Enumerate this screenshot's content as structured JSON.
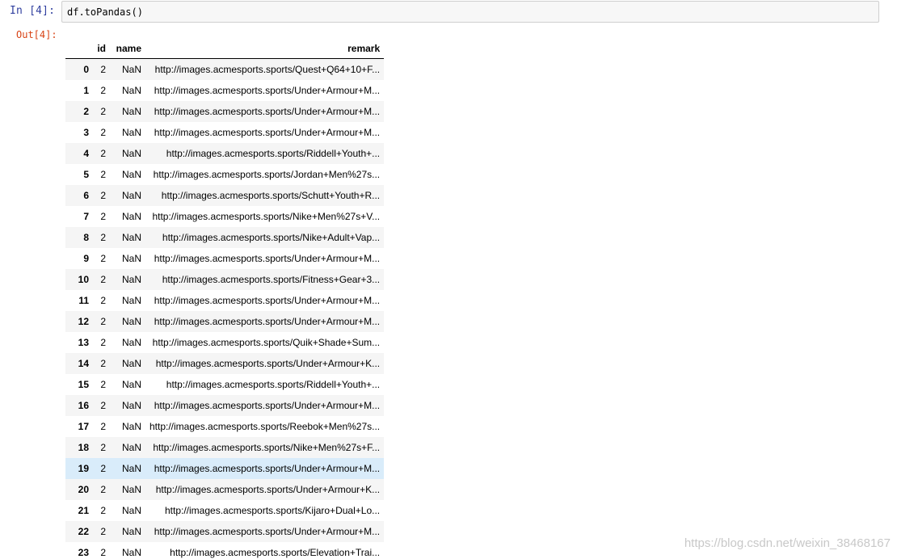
{
  "cell": {
    "in_prompt": "In  [4]:",
    "code": "df.toPandas()",
    "out_prompt": "Out[4]:"
  },
  "table": {
    "columns": [
      "",
      "id",
      "name",
      "remark"
    ],
    "rows": [
      {
        "idx": "0",
        "id": "2",
        "name": "NaN",
        "remark": "http://images.acmesports.sports/Quest+Q64+10+F..."
      },
      {
        "idx": "1",
        "id": "2",
        "name": "NaN",
        "remark": "http://images.acmesports.sports/Under+Armour+M..."
      },
      {
        "idx": "2",
        "id": "2",
        "name": "NaN",
        "remark": "http://images.acmesports.sports/Under+Armour+M..."
      },
      {
        "idx": "3",
        "id": "2",
        "name": "NaN",
        "remark": "http://images.acmesports.sports/Under+Armour+M..."
      },
      {
        "idx": "4",
        "id": "2",
        "name": "NaN",
        "remark": "http://images.acmesports.sports/Riddell+Youth+..."
      },
      {
        "idx": "5",
        "id": "2",
        "name": "NaN",
        "remark": "http://images.acmesports.sports/Jordan+Men%27s..."
      },
      {
        "idx": "6",
        "id": "2",
        "name": "NaN",
        "remark": "http://images.acmesports.sports/Schutt+Youth+R..."
      },
      {
        "idx": "7",
        "id": "2",
        "name": "NaN",
        "remark": "http://images.acmesports.sports/Nike+Men%27s+V..."
      },
      {
        "idx": "8",
        "id": "2",
        "name": "NaN",
        "remark": "http://images.acmesports.sports/Nike+Adult+Vap..."
      },
      {
        "idx": "9",
        "id": "2",
        "name": "NaN",
        "remark": "http://images.acmesports.sports/Under+Armour+M..."
      },
      {
        "idx": "10",
        "id": "2",
        "name": "NaN",
        "remark": "http://images.acmesports.sports/Fitness+Gear+3..."
      },
      {
        "idx": "11",
        "id": "2",
        "name": "NaN",
        "remark": "http://images.acmesports.sports/Under+Armour+M..."
      },
      {
        "idx": "12",
        "id": "2",
        "name": "NaN",
        "remark": "http://images.acmesports.sports/Under+Armour+M..."
      },
      {
        "idx": "13",
        "id": "2",
        "name": "NaN",
        "remark": "http://images.acmesports.sports/Quik+Shade+Sum..."
      },
      {
        "idx": "14",
        "id": "2",
        "name": "NaN",
        "remark": "http://images.acmesports.sports/Under+Armour+K..."
      },
      {
        "idx": "15",
        "id": "2",
        "name": "NaN",
        "remark": "http://images.acmesports.sports/Riddell+Youth+..."
      },
      {
        "idx": "16",
        "id": "2",
        "name": "NaN",
        "remark": "http://images.acmesports.sports/Under+Armour+M..."
      },
      {
        "idx": "17",
        "id": "2",
        "name": "NaN",
        "remark": "http://images.acmesports.sports/Reebok+Men%27s..."
      },
      {
        "idx": "18",
        "id": "2",
        "name": "NaN",
        "remark": "http://images.acmesports.sports/Nike+Men%27s+F..."
      },
      {
        "idx": "19",
        "id": "2",
        "name": "NaN",
        "remark": "http://images.acmesports.sports/Under+Armour+M...",
        "highlight": true
      },
      {
        "idx": "20",
        "id": "2",
        "name": "NaN",
        "remark": "http://images.acmesports.sports/Under+Armour+K..."
      },
      {
        "idx": "21",
        "id": "2",
        "name": "NaN",
        "remark": "http://images.acmesports.sports/Kijaro+Dual+Lo..."
      },
      {
        "idx": "22",
        "id": "2",
        "name": "NaN",
        "remark": "http://images.acmesports.sports/Under+Armour+M..."
      },
      {
        "idx": "23",
        "id": "2",
        "name": "NaN",
        "remark": "http://images.acmesports.sports/Elevation+Trai..."
      }
    ],
    "highlight_color": "#d9ecfa"
  },
  "watermark": "https://blog.csdn.net/weixin_38468167"
}
